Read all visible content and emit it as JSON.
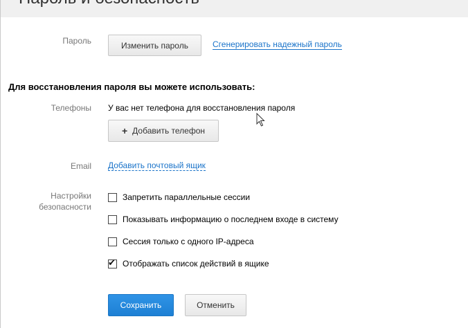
{
  "page_title": "Пароль и безопасность",
  "password": {
    "label": "Пароль",
    "change_button": "Изменить пароль",
    "generate_link": "Сгенерировать надежный пароль"
  },
  "recovery_heading": "Для восстановления пароля вы можете использовать:",
  "phones": {
    "label": "Телефоны",
    "status_text": "У вас нет телефона для восстановления пароля",
    "add_button": "Добавить телефон",
    "add_icon": "+"
  },
  "email": {
    "label": "Email",
    "add_link": "Добавить почтовый ящик"
  },
  "security": {
    "label_line1": "Настройки",
    "label_line2": "безопасности",
    "options": [
      {
        "label": "Запретить параллельные сессии",
        "checked": false
      },
      {
        "label": "Показывать информацию о последнем входе в систему",
        "checked": false
      },
      {
        "label": "Сессия только с одного IP-адреса",
        "checked": false
      },
      {
        "label": "Отображать список действий в ящике",
        "checked": true
      }
    ]
  },
  "actions": {
    "save": "Сохранить",
    "cancel": "Отменить"
  },
  "colors": {
    "link": "#1a73c9",
    "primary_button": "#1d80d4"
  }
}
